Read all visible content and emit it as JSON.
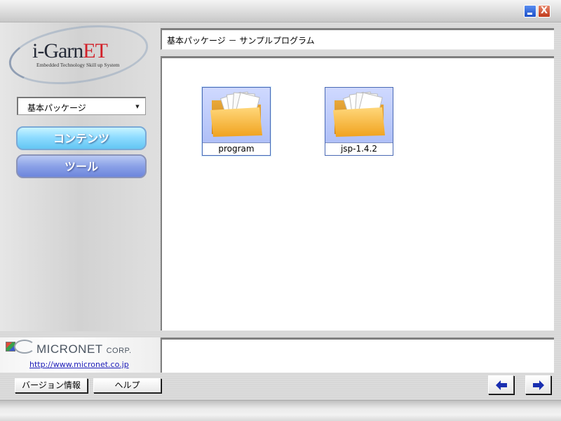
{
  "window": {
    "minimize_label": "_",
    "close_label": "X"
  },
  "logo": {
    "name_main": "i-Garn",
    "name_accent": "ET",
    "subtitle": "Embedded Technology Skill up System"
  },
  "package_select": {
    "value": "基本パッケージ"
  },
  "nav": {
    "contents_label": "コンテンツ",
    "tools_label": "ツール"
  },
  "header": {
    "path": "基本パッケージ － サンプルプログラム"
  },
  "folders": [
    {
      "label": "program",
      "icon": "folder-icon",
      "selected": true
    },
    {
      "label": "jsp-1.4.2",
      "icon": "folder-icon",
      "selected": false
    }
  ],
  "brand": {
    "name": "MICRONET",
    "suffix": "CORP.",
    "url": "http://www.micronet.co.jp"
  },
  "footer": {
    "version_label": "バージョン情報",
    "help_label": "ヘルプ",
    "back_icon": "arrow-left-icon",
    "forward_icon": "arrow-right-icon"
  },
  "colors": {
    "tile_bg": "#a8baf5",
    "tile_border": "#4a69b4",
    "logo_accent": "#d21f28",
    "nav_active": "#63c6f3",
    "nav_inactive": "#6d86dc",
    "arrow": "#1a2fb0"
  }
}
